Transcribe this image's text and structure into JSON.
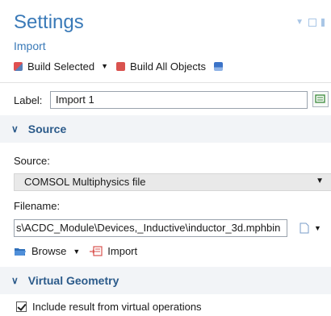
{
  "header": {
    "title": "Settings",
    "subtitle": "Import"
  },
  "toolbar": {
    "build_selected": "Build Selected",
    "build_all": "Build All Objects"
  },
  "label_row": {
    "label": "Label:",
    "value": "Import 1"
  },
  "source_section": {
    "title": "Source",
    "source_label": "Source:",
    "source_value": "COMSOL Multiphysics file",
    "filename_label": "Filename:",
    "filename_value": "s\\ACDC_Module\\Devices,_Inductive\\inductor_3d.mphbin",
    "browse": "Browse",
    "import": "Import"
  },
  "virtual_section": {
    "title": "Virtual Geometry",
    "checkbox_label": "Include result from virtual operations",
    "checked": true
  },
  "colors": {
    "accent": "#3a7ab8",
    "section_bg": "#f2f4f7"
  }
}
